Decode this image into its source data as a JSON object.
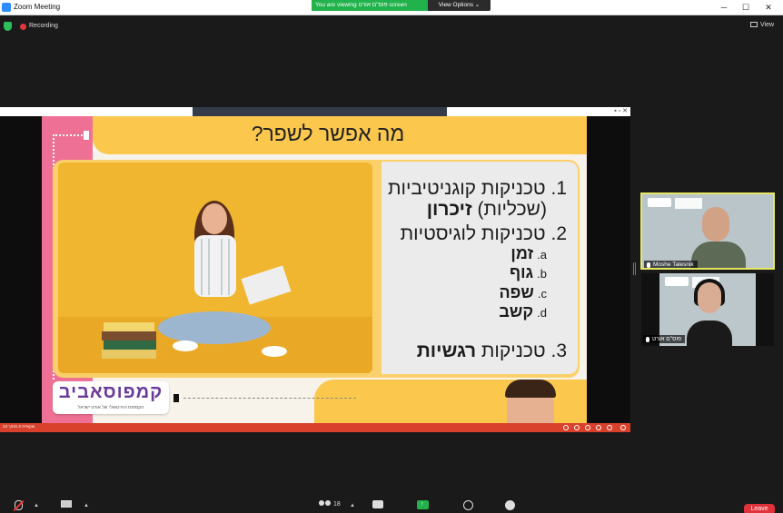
{
  "window": {
    "title": "Zoom Meeting",
    "banner": "You are viewing פוס''ם אורט screen",
    "view_options": "View Options ⌄",
    "minimize": "─",
    "maximize": "☐",
    "close": "✕"
  },
  "top_toolbar": {
    "recording": "Recording",
    "view": "View"
  },
  "slide": {
    "title": "מה אפשר לשפר?",
    "items": [
      {
        "num": "1.",
        "line1": "טכניקות קוגניטיביות",
        "line2_prefix": "(שכליות) ",
        "line2_bold": "זיכרון"
      },
      {
        "num": "2.",
        "text": "טכניקות לוגיסטיות"
      },
      {
        "num": "3.",
        "text_prefix": "טכניקות ",
        "text_bold": "רגשיות"
      }
    ],
    "subitems": [
      {
        "marker": "a.",
        "text": "זמן"
      },
      {
        "marker": "b.",
        "text": "גוף"
      },
      {
        "marker": "c.",
        "text": "שפה"
      },
      {
        "marker": "d.",
        "text": "קשב"
      }
    ],
    "logo": "קמפוסאביב",
    "logo_sub": "הקמפוס הוירטואלי של אורט ישראל"
  },
  "share_footer": {
    "slide_counter": "שקופית 3 מתוך 13"
  },
  "participants": [
    {
      "name": "Moshe Talesnik"
    },
    {
      "name": "פוס''ם אורט"
    }
  ],
  "bottom_toolbar": {
    "participant_count": "18",
    "leave": "Leave"
  },
  "colors": {
    "pink": "#ef7095",
    "yellow": "#fbc84d",
    "banner_green": "#22b24c",
    "leave_red": "#e0323a"
  }
}
